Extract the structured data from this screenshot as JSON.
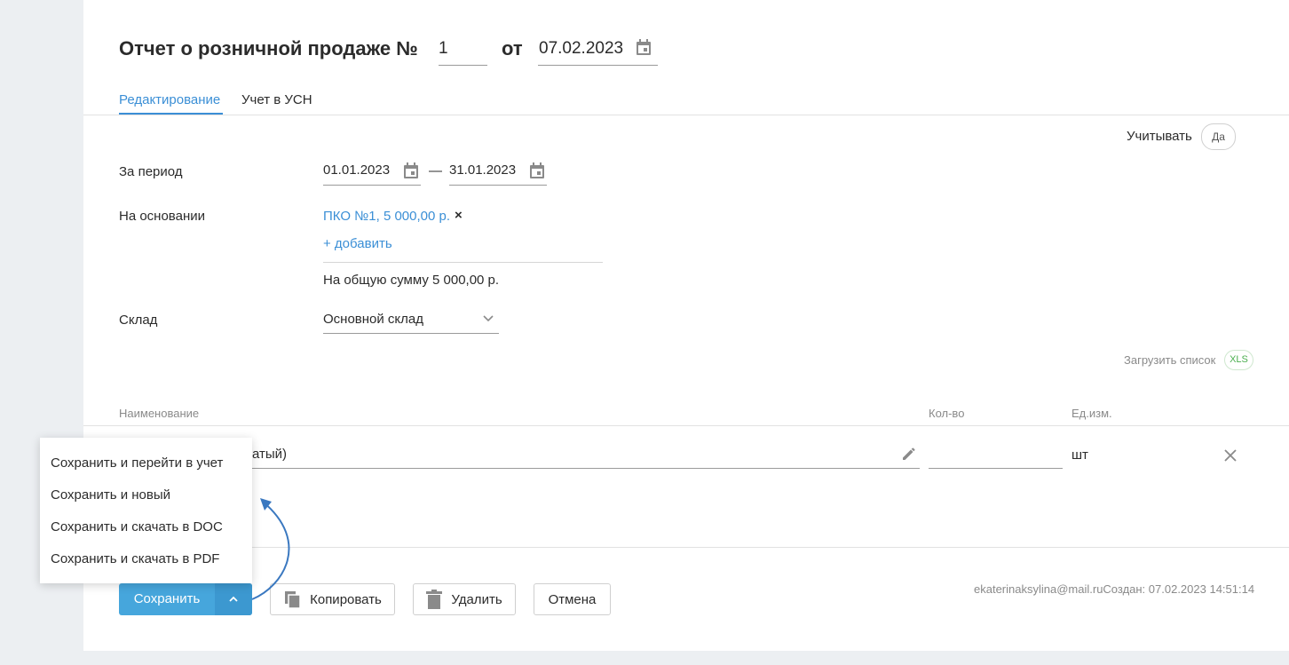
{
  "header": {
    "title": "Отчет о розничной продаже №",
    "number": "1",
    "from_label": "от",
    "date": "07.02.2023"
  },
  "tabs": [
    {
      "label": "Редактирование",
      "active": true
    },
    {
      "label": "Учет в УСН",
      "active": false
    }
  ],
  "consider": {
    "label": "Учитывать",
    "value": "Да"
  },
  "form": {
    "period_label": "За период",
    "period_from": "01.01.2023",
    "period_dash": "—",
    "period_to": "31.01.2023",
    "basis_label": "На основании",
    "basis_item": "ПКО №1, 5 000,00 р.",
    "basis_remove": "×",
    "add_link": "+ добавить",
    "total_text": "На общую сумму 5 000,00 р.",
    "warehouse_label": "Склад",
    "warehouse_value": "Основной склад"
  },
  "upload": {
    "label": "Загрузить список",
    "badge": "XLS"
  },
  "table": {
    "columns": [
      "Наименование",
      "Кол-во",
      "Ед.изм."
    ],
    "row": {
      "name_partial": "атый)",
      "qty": "",
      "unit": "шт"
    }
  },
  "menu": {
    "items": [
      "Сохранить и перейти в учет",
      "Сохранить и новый",
      "Сохранить и скачать в DOC",
      "Сохранить и скачать в PDF"
    ]
  },
  "footer": {
    "save": "Сохранить",
    "copy": "Копировать",
    "delete": "Удалить",
    "cancel": "Отмена",
    "meta": "ekaterinaksylina@mail.ruСоздан: 07.02.2023 14:51:14"
  },
  "colors": {
    "accent": "#3b8fd6",
    "save_button": "#46a6dc",
    "save_button_arrow": "#3c98d0",
    "arrow": "#3a78c0",
    "xls_badge": "#4caf50"
  }
}
